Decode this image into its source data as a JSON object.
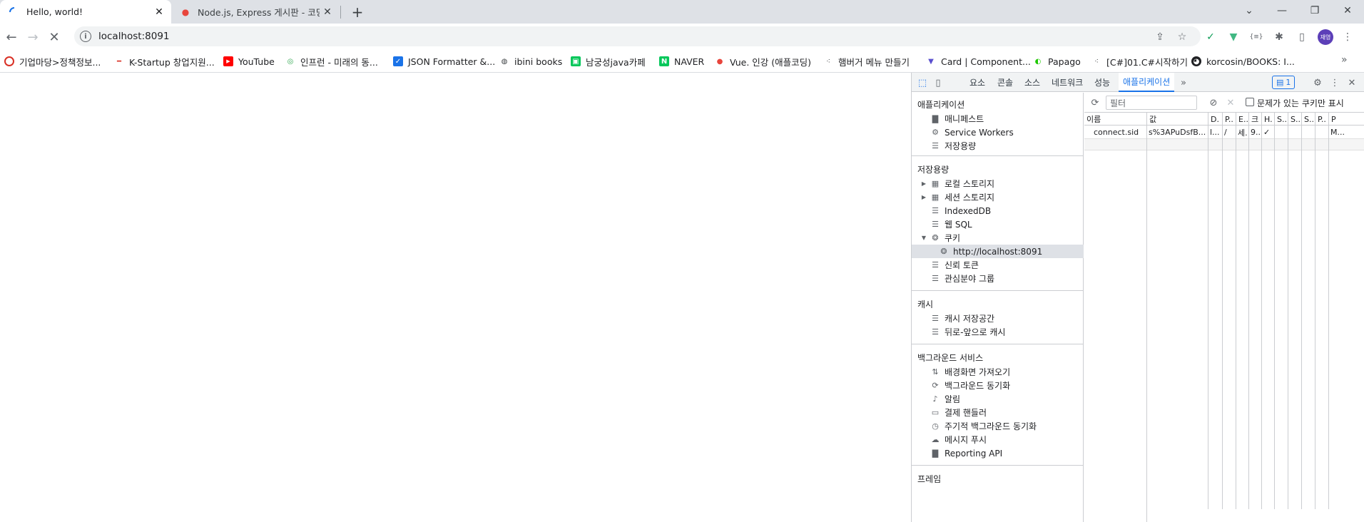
{
  "tabs": [
    {
      "title": "Hello, world!",
      "favicon": "loading-spinner-icon"
    },
    {
      "title": "Node.js, Express 게시판 - 코딩애플",
      "favicon": "apple-icon"
    }
  ],
  "toolbar": {
    "url": "localhost:8091",
    "avatar_text": "재영"
  },
  "bookmarks": [
    {
      "label": "기업마당>정책정보...",
      "color": "#d93025"
    },
    {
      "label": "K-Startup 창업지원...",
      "color": "#9e9e9e"
    },
    {
      "label": "YouTube",
      "color": "#ff0000"
    },
    {
      "label": "인프런 - 미래의 동...",
      "color": "#34a853"
    },
    {
      "label": "JSON Formatter &...",
      "color": "#1a73e8"
    },
    {
      "label": "ibini books",
      "color": "#3c4043"
    },
    {
      "label": "남궁성java카페",
      "color": "#03c75a"
    },
    {
      "label": "NAVER",
      "color": "#03c75a"
    },
    {
      "label": "Vue. 인강 (애플코딩)",
      "color": "#e8453c"
    },
    {
      "label": "햄버거 메뉴 만들기",
      "color": "#3c4043"
    },
    {
      "label": "Card | Component...",
      "color": "#5a4fcf"
    },
    {
      "label": "Papago",
      "color": "#1ec800"
    },
    {
      "label": "[C#]01.C#시작하기",
      "color": "#3c4043"
    },
    {
      "label": "korcosin/BOOKS: I...",
      "color": "#202124"
    }
  ],
  "devtools": {
    "tabs": [
      "요소",
      "콘솔",
      "소스",
      "네트워크",
      "성능",
      "애플리케이션"
    ],
    "active_tab": "애플리케이션",
    "issue_count": "1",
    "sidebar": {
      "app_title": "애플리케이션",
      "app_items": [
        "매니페스트",
        "Service Workers",
        "저장용량"
      ],
      "storage_title": "저장용량",
      "storage_items": [
        "로컬 스토리지",
        "세션 스토리지",
        "IndexedDB",
        "웹 SQL",
        "쿠키",
        "http://localhost:8091",
        "신뢰 토큰",
        "관심분야 그룹"
      ],
      "cache_title": "캐시",
      "cache_items": [
        "캐시 저장공간",
        "뒤로-앞으로 캐시"
      ],
      "bg_title": "백그라운드 서비스",
      "bg_items": [
        "배경화면 가져오기",
        "백그라운드 동기화",
        "알림",
        "결제 핸들러",
        "주기적 백그라운드 동기화",
        "메시지 푸시",
        "Reporting API"
      ],
      "frames_title": "프레임"
    },
    "cookies": {
      "filter_placeholder": "필터",
      "only_issues_label": "문제가 있는 쿠키만 표시",
      "columns": [
        "이름",
        "값",
        "D.",
        "P..",
        "E..",
        "크",
        "H.",
        "S..",
        "S..",
        "S..",
        "P..",
        "P"
      ],
      "rows": [
        {
          "name": "connect.sid",
          "value": "s%3APuDsfB...",
          "domain": "l...",
          "path": "/",
          "expires": "세.",
          "size": "9...",
          "httponly": "✓",
          "p": "M..."
        }
      ]
    }
  }
}
